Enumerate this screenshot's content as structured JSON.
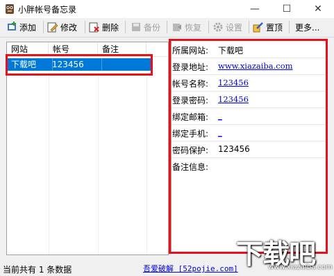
{
  "window": {
    "title": "小胖帐号备忘录",
    "min": "—",
    "max": "☐",
    "close": "✕"
  },
  "toolbar": {
    "add": "添加",
    "edit": "修改",
    "delete": "删除",
    "backup": "备份",
    "restore": "恢复",
    "settings": "设置",
    "pin": "置顶",
    "more": "更多..."
  },
  "list": {
    "columns": [
      "网站",
      "帐号",
      "备注"
    ],
    "rows": [
      {
        "site": "下载吧",
        "account": "123456",
        "note": ""
      }
    ]
  },
  "details": {
    "site_label": "所属网站:",
    "site_value": "下载吧",
    "url_label": "登录地址:",
    "url_value": "www.xiazaiba.com",
    "account_label": "帐号名称:",
    "account_value": "123456",
    "password_label": "登录密码:",
    "password_value": "123456",
    "email_label": "绑定邮箱:",
    "email_value": "_",
    "phone_label": "绑定手机:",
    "phone_value": "_",
    "protect_label": "密码保护:",
    "protect_value": "123456",
    "note_label": "备注信息:"
  },
  "status": {
    "count_text": "当前共有 1 条数据",
    "link_text": "吾爱破解 [52pojie.com]"
  },
  "watermark": {
    "text": "下载吧",
    "url": "www.xiazaiba.com"
  },
  "colors": {
    "highlight": "#e8101a",
    "selection": "#0078d7",
    "link": "#0000ee"
  }
}
